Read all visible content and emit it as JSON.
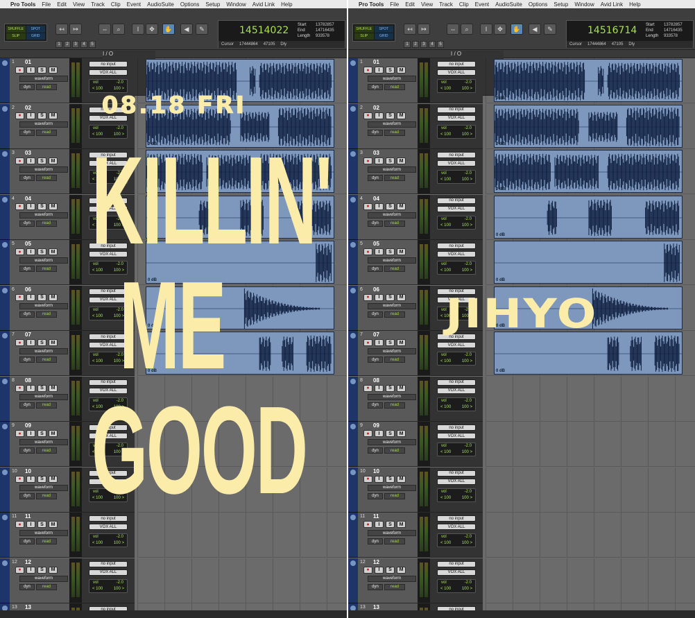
{
  "menu": [
    "Pro Tools",
    "File",
    "Edit",
    "View",
    "Track",
    "Clip",
    "Event",
    "AudioSuite",
    "Options",
    "Setup",
    "Window",
    "Avid Link",
    "Help"
  ],
  "modes": [
    "SHUFFLE",
    "SPOT",
    "SLIP",
    "GRID"
  ],
  "counter_left": {
    "main": "14514022",
    "start": "13782857",
    "end": "14716435",
    "length": "933578",
    "cursor": "17444864",
    "extra": "47105"
  },
  "counter_right": {
    "main": "14516714",
    "start": "13782857",
    "end": "14716435",
    "length": "933578",
    "cursor": "17444864",
    "extra": "47105"
  },
  "labels": {
    "start": "Start",
    "end": "End",
    "length": "Length",
    "cursor": "Cursor",
    "io": "I / O",
    "dly": "Dly"
  },
  "grid_numbers": [
    "1",
    "2",
    "3",
    "4",
    "5"
  ],
  "track_defaults": {
    "input": "no input",
    "output": "VOX ALL",
    "view": "waveform",
    "dyn": "dyn",
    "mode": "read",
    "vol_label": "vol",
    "vol": "-2.0",
    "pan_l": "< 100",
    "pan_r": "100 >",
    "gain": "0 dB"
  },
  "tracks": [
    "01",
    "02",
    "03",
    "04",
    "05",
    "06",
    "07",
    "08",
    "09",
    "10",
    "11",
    "12",
    "13"
  ],
  "overlay": {
    "date": "08.18 FRI",
    "title_lines": [
      "KILLIN'",
      "ME",
      "GOOD"
    ],
    "artist": "JIHYO"
  },
  "accent": "#fbecaa"
}
